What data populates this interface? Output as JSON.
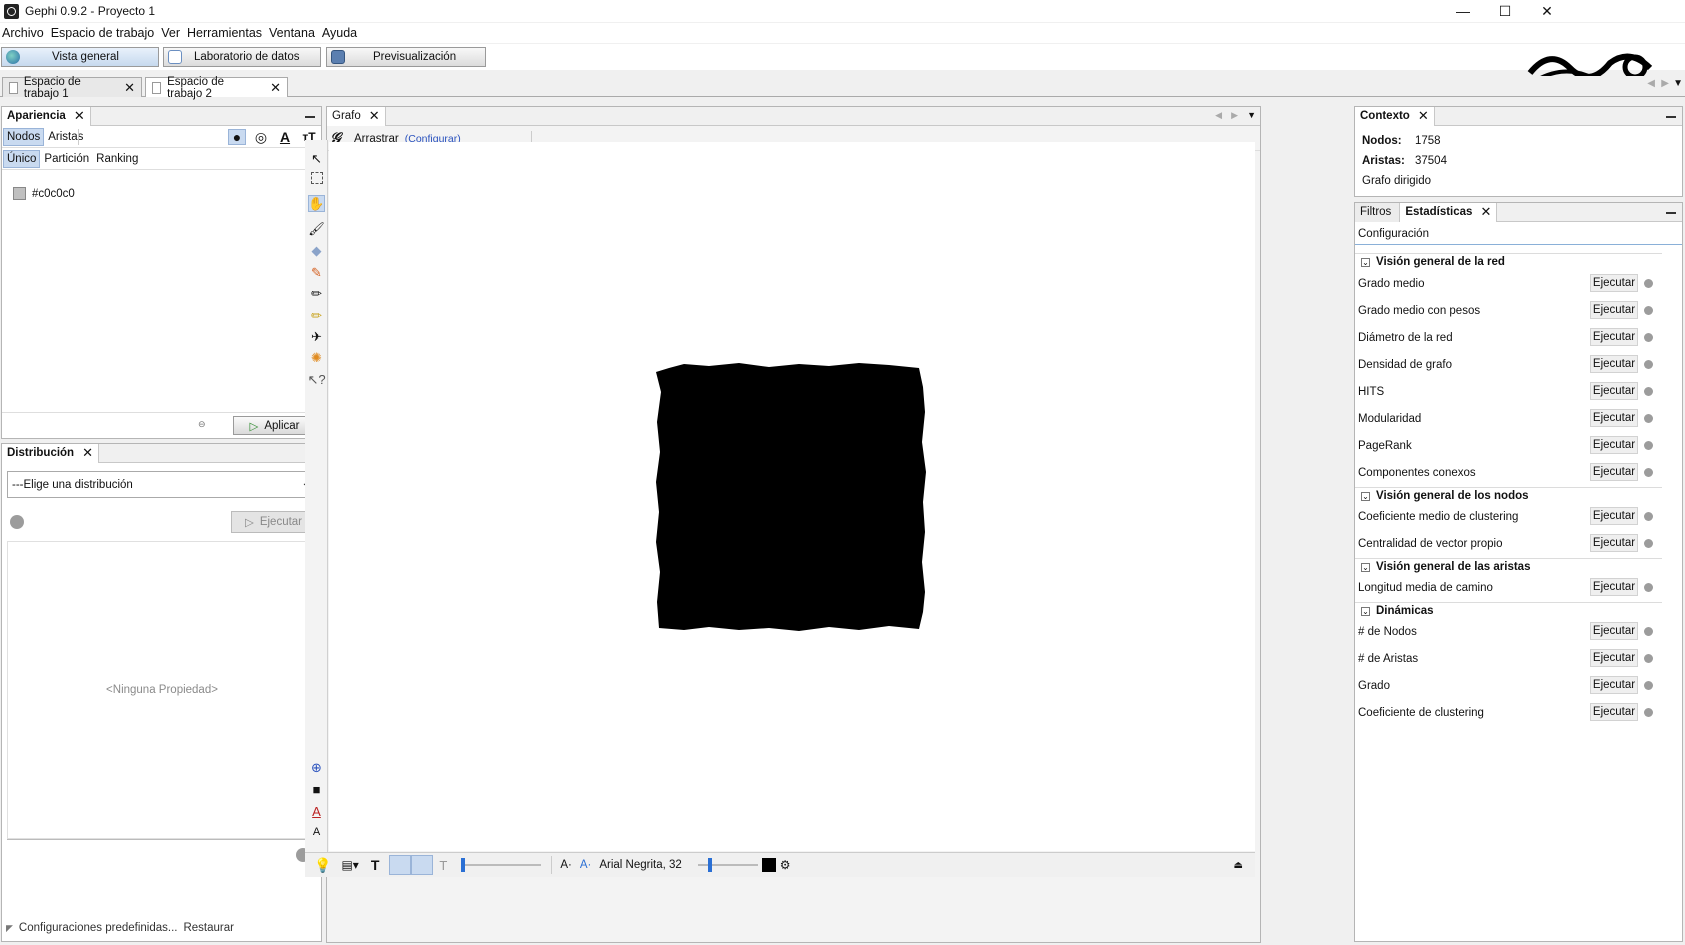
{
  "window": {
    "title": "Gephi 0.9.2 - Proyecto 1",
    "minimize_glyph": "—",
    "maximize_glyph": "☐",
    "close_glyph": "✕"
  },
  "menu": [
    "Archivo",
    "Espacio de trabajo",
    "Ver",
    "Herramientas",
    "Ventana",
    "Ayuda"
  ],
  "perspectives": {
    "overview": "Vista general",
    "data_lab": "Laboratorio de datos",
    "preview": "Previsualización"
  },
  "workspaces": [
    "Espacio de trabajo 1",
    "Espacio de trabajo 2"
  ],
  "appearance": {
    "title": "Apariencia",
    "element_tabs": [
      "Nodos",
      "Aristas"
    ],
    "mode_tabs": [
      "Único",
      "Partición",
      "Ranking"
    ],
    "color_value": "#c0c0c0",
    "swatch_color": "#c0c0c0",
    "apply_label": "Aplicar"
  },
  "layout": {
    "title": "Distribución",
    "select_value": "---Elige una distribución",
    "run_label": "Ejecutar",
    "no_property": "<Ninguna Propiedad>",
    "presets": "Configuraciones predefinidas...",
    "restore": "Restaurar"
  },
  "graph": {
    "tab_title": "Grafo",
    "tool_name": "Arrastrar",
    "configure_link": "(Configurar)",
    "font_label": "Arial Negrita, 32",
    "edge_color": "#000000"
  },
  "context": {
    "title": "Contexto",
    "nodes_label": "Nodos:",
    "nodes_value": "1758",
    "edges_label": "Aristas:",
    "edges_value": "37504",
    "graph_type": "Grafo dirigido"
  },
  "stats_panel": {
    "filters_tab": "Filtros",
    "stats_tab": "Estadísticas",
    "settings": "Configuración",
    "run_label": "Ejecutar",
    "groups": [
      {
        "title": "Visión general de la red",
        "items": [
          "Grado medio",
          "Grado medio con pesos",
          "Diámetro de la red",
          "Densidad de grafo",
          "HITS",
          "Modularidad",
          "PageRank",
          "Componentes conexos"
        ]
      },
      {
        "title": "Visión general de los nodos",
        "items": [
          "Coeficiente medio de clustering",
          "Centralidad de vector propio"
        ]
      },
      {
        "title": "Visión general de las aristas",
        "items": [
          "Longitud media de camino"
        ]
      },
      {
        "title": "Dinámicas",
        "items": [
          "# de Nodos",
          "# de Aristas",
          "Grado",
          "Coeficiente de clustering"
        ]
      }
    ]
  }
}
